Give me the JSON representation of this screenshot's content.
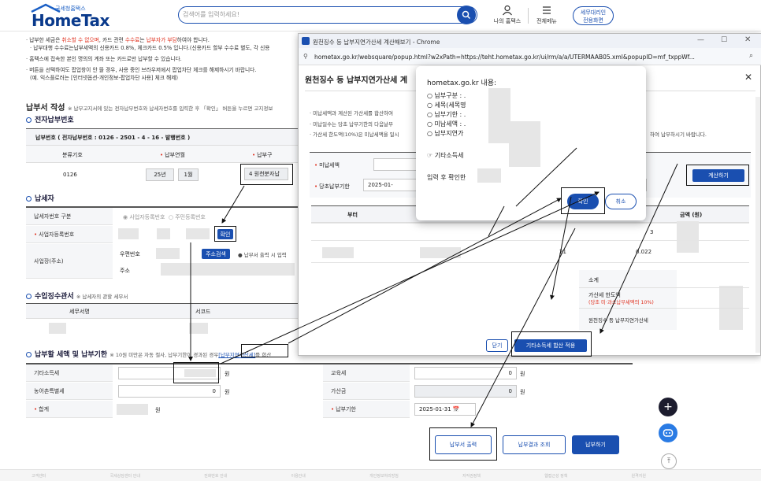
{
  "header": {
    "logo_small": "국세청홈택스",
    "logo_big": "HomeTax",
    "search_placeholder": "검색어를 입력하세요!",
    "my_hometax": "나의 홈택스",
    "all_menu": "전체메뉴",
    "tax_agent_line1": "세무대리인",
    "tax_agent_line2": "전용화면"
  },
  "notices": [
    "· 납부한 세금은 취소할 수 없으며, 카드 관련 수수료는 납부자가 부담하여야 합니다.",
    "· 납부대행 수수료는납부세액의 신용카드 0.8%, 체크카드 0.5% 입니다.(신용카드 할부 수수료 별도, 각 신용",
    "· 홈택스에 접속한 본인 명의의 계좌 또는 카드로만 납부할 수 있습니다.",
    "· 버튼을 선택하여도 팝업창이 안 뜰 경우, 사용 중인 브라우저에서 팝업차단 체크를 해제하시기 바랍니다.",
    "(예. 익스플로러는 [인터넷옵션-개인정보-팝업차단 사용] 체크 해제)"
  ],
  "form": {
    "title": "납부서 작성",
    "title_note": "※ 납부고지서에 있는 전자납부번호와 납세자번호를 입력한 후 「확인」 버튼을 누르면 고지정보",
    "e_payment_heading": "전자납부번호",
    "e_payment_label": "납부번호 ( 전자납부번호 : 0126 - 2501 - 4 - 16 - 발행번호 )",
    "col_category": "분류기호",
    "col_year_month": "납부연월",
    "col_type": "납부구",
    "category_value": "0126",
    "year_value": "25년",
    "month_value": "1월",
    "type_value": "4 원천분자납",
    "taxpayer_heading": "납세자",
    "taxpayer_type_label": "납세자번호 구분",
    "radio_business": "사업자등록번호",
    "radio_resident": "주민등록번호",
    "business_no_label": "사업자등록번호",
    "confirm_btn": "확인",
    "address_label": "사업장(주소)",
    "postal_label": "우편번호",
    "address_search_btn": "주소검색",
    "address_note": "납부서 출력 시 입력",
    "address_sub_label": "주소",
    "office_heading": "수입징수관서",
    "office_note": "※ 납세자의 관할 세무서",
    "col_office_name": "세무서명",
    "col_office_code": "서코드",
    "amount_heading": "납부할 세액 및 납부기한",
    "amount_note_pre": "※ 10원 미만은 자동 절사, 납부기한이 경과된 경우",
    "amount_note_link": "[납부지연가산세]",
    "amount_note_post": "를 합산",
    "other_income_tax_label": "기타소득세",
    "won": "원",
    "education_tax_label": "교육세",
    "education_tax_value": "0",
    "rural_tax_label": "농어촌특별세",
    "rural_tax_value": "0",
    "surcharge_label": "가산금",
    "surcharge_value": "0",
    "total_label": "합계",
    "due_date_label": "납부기한",
    "due_date_value": "2025-01-31",
    "print_btn": "납부서 출력",
    "result_btn": "납부결과 조회",
    "pay_btn": "납부하기"
  },
  "popup": {
    "window_title": "원천징수 등 납부지연가산세 계산해보기 - Chrome",
    "url": "hometax.go.kr/websquare/popup.html?w2xPath=https://teht.hometax.go.kr/ui/rm/a/a/UTERMAAB05.xml&popupID=mf_txppWf...",
    "page_title": "원천징수 등 납부지연가산세 계",
    "bullet1": "· 미납세액과 계산된 가산세를 합산하여",
    "bullet2": "· 미납일수는 당초 납부기한의 다음날부",
    "bullet3": "· 가산세 한도액(10%)은 미납세액을 일시",
    "bullet_tail": "하여 납부하시기 바랍니다.",
    "unpaid_label": "미납세액",
    "due_label": "당초납부기한",
    "due_value": "2025-01-",
    "calc_btn": "계산하기",
    "col_from": "부터",
    "col_amount": "금액 (원)",
    "row1_value": "3",
    "row2_days": "21",
    "row2_rate": "0.022",
    "subtotal_label": "소계",
    "limit_label": "가산세 한도액",
    "limit_sub": "(당초 미·과소납부세액의 10%)",
    "penalty_label": "원천징수 등 납부지연가산세",
    "close_btn": "닫기",
    "apply_btn": "기타소득세 합산 적용"
  },
  "alert": {
    "title": "hometax.go.kr 내용:",
    "line1": "○ 납부구분 : .",
    "line2": "○ 세목(세목명",
    "line3": "○ 납부기한 : .",
    "line4": "○ 미납세액 : .",
    "line5": "○ 납부지연가",
    "line6": "☞ 기타소득세",
    "line7": "입력 후 확인한",
    "ok_btn": "확인",
    "cancel_btn": "취소"
  },
  "footer_items": [
    "고객센터",
    "국세상담센터 안내",
    "전화번호 안내",
    "이용안내",
    "개인정보처리방침",
    "저작권정책",
    "웹접근성 정책",
    "원격지원"
  ],
  "colors": {
    "brand": "#1a4fb0",
    "accent_red": "#e0301e",
    "annotation": "#111111"
  }
}
